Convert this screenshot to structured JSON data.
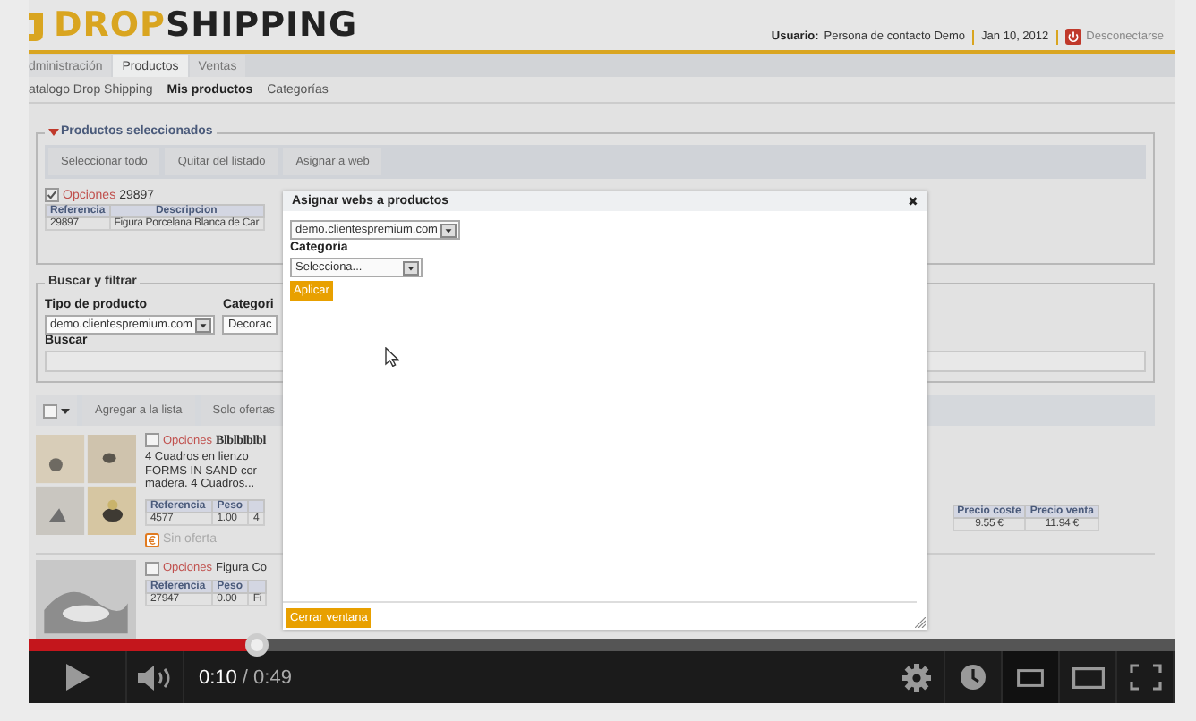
{
  "header": {
    "logo_left": "DROP",
    "logo_right": "SHIPPING",
    "user_label": "Usuario:",
    "user_name": "Persona de contacto Demo",
    "date": "Jan 10, 2012",
    "logout": "Desconectarse"
  },
  "tabs": [
    {
      "label": "dministración",
      "selected": false
    },
    {
      "label": "Productos",
      "selected": true
    },
    {
      "label": "Ventas",
      "selected": false
    }
  ],
  "subnav": [
    {
      "label": "atalogo Drop Shipping",
      "selected": false
    },
    {
      "label": "Mis productos",
      "selected": true
    },
    {
      "label": "Categorías",
      "selected": false
    }
  ],
  "selected_products": {
    "title": "Productos seleccionados",
    "expanded": true,
    "buttons": [
      "Seleccionar todo",
      "Quitar del listado",
      "Asignar a web"
    ],
    "item": {
      "checked": true,
      "options": "Opciones",
      "code": "29897",
      "columns": [
        "Referencia",
        "Descripcion"
      ],
      "row": [
        "29897",
        "Figura Porcelana Blanca de Car"
      ]
    }
  },
  "filter": {
    "title": "Buscar y filtrar",
    "type_label": "Tipo de producto",
    "type_value": "demo.clientespremium.com",
    "category_label": "Categori",
    "category_value": "Decorac",
    "search_label": "Buscar"
  },
  "toolbar": {
    "select_all_checked": false,
    "buttons": [
      "Agregar a la lista",
      "Solo ofertas"
    ]
  },
  "products": [
    {
      "checked": false,
      "options": "Opciones",
      "name": "Blblblblbl",
      "description": [
        "4 Cuadros en lienzo",
        "FORMS IN SAND cor",
        "madera. 4 Cuadros..."
      ],
      "columns": [
        "Referencia",
        "Peso"
      ],
      "row": [
        "4577",
        "1.00",
        "4"
      ],
      "offer": "Sin oferta",
      "price_columns": [
        "Precio coste",
        "Precio venta"
      ],
      "prices": [
        "9.55 €",
        "11.94 €"
      ]
    },
    {
      "checked": false,
      "options": "Opciones",
      "name": "Figura Co",
      "columns": [
        "Referencia",
        "Peso"
      ],
      "row": [
        "27947",
        "0.00",
        "Fi"
      ]
    }
  ],
  "modal": {
    "title": "Asignar webs a productos",
    "close": "✖",
    "web_value": "demo.clientespremium.com",
    "category_label": "Categoria",
    "category_value": "Selecciona...",
    "apply": "Aplicar",
    "close_button": "Cerrar ventana"
  },
  "player": {
    "playing": false,
    "level": 0.2,
    "current_time": "0:10",
    "duration": "/ 0:49"
  }
}
